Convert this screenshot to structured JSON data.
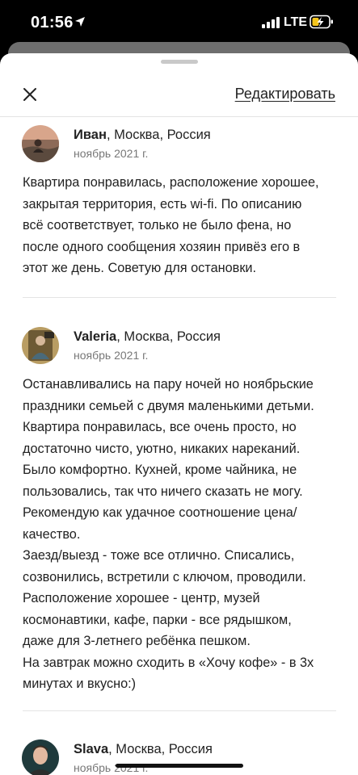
{
  "status_bar": {
    "time": "01:56",
    "network": "LTE",
    "icons": [
      "location-arrow-icon",
      "signal-icon",
      "battery-charging-icon"
    ]
  },
  "header": {
    "close_icon": "close-icon",
    "edit_label": "Редактировать"
  },
  "reviews": [
    {
      "name": "Иван",
      "location": ", Москва, Россия",
      "date": "ноябрь 2021 г.",
      "text": "Квартира понравилась, расположение хорошее,\nзакрытая территория, есть wi-fi. По описанию\nвсё соответствует, только не было фена, но\nпосле одного сообщения хозяин привёз его в\nэтот же день. Советую для остановки."
    },
    {
      "name": "Valeria",
      "location": ", Москва, Россия",
      "date": "ноябрь 2021 г.",
      "text": "Останавливались на пару ночей но ноябрьские\nпраздники семьей с двумя маленькими детьми.\nКвартира понравилась, все очень просто, но\nдостаточно чисто, уютно, никаких нареканий.\nБыло комфортно. Кухней, кроме чайника, не\nпользовались, так что ничего сказать не могу.\nРекомендую как удачное соотношение цена/\nкачество.\nЗаезд/выезд - тоже все отлично. Списались,\nсозвонились, встретили с ключом, проводили.\nРасположение хорошее - центр, музей\nкосмонавтики, кафе, парки - все рядышком,\nдаже для 3-летнего ребёнка пешком.\nНа завтрак можно сходить в «Хочу кофе» - в 3х\nминутах и вкусно:)"
    },
    {
      "name": "Slava",
      "location": ", Москва, Россия",
      "date": "ноябрь 2021 г."
    }
  ]
}
